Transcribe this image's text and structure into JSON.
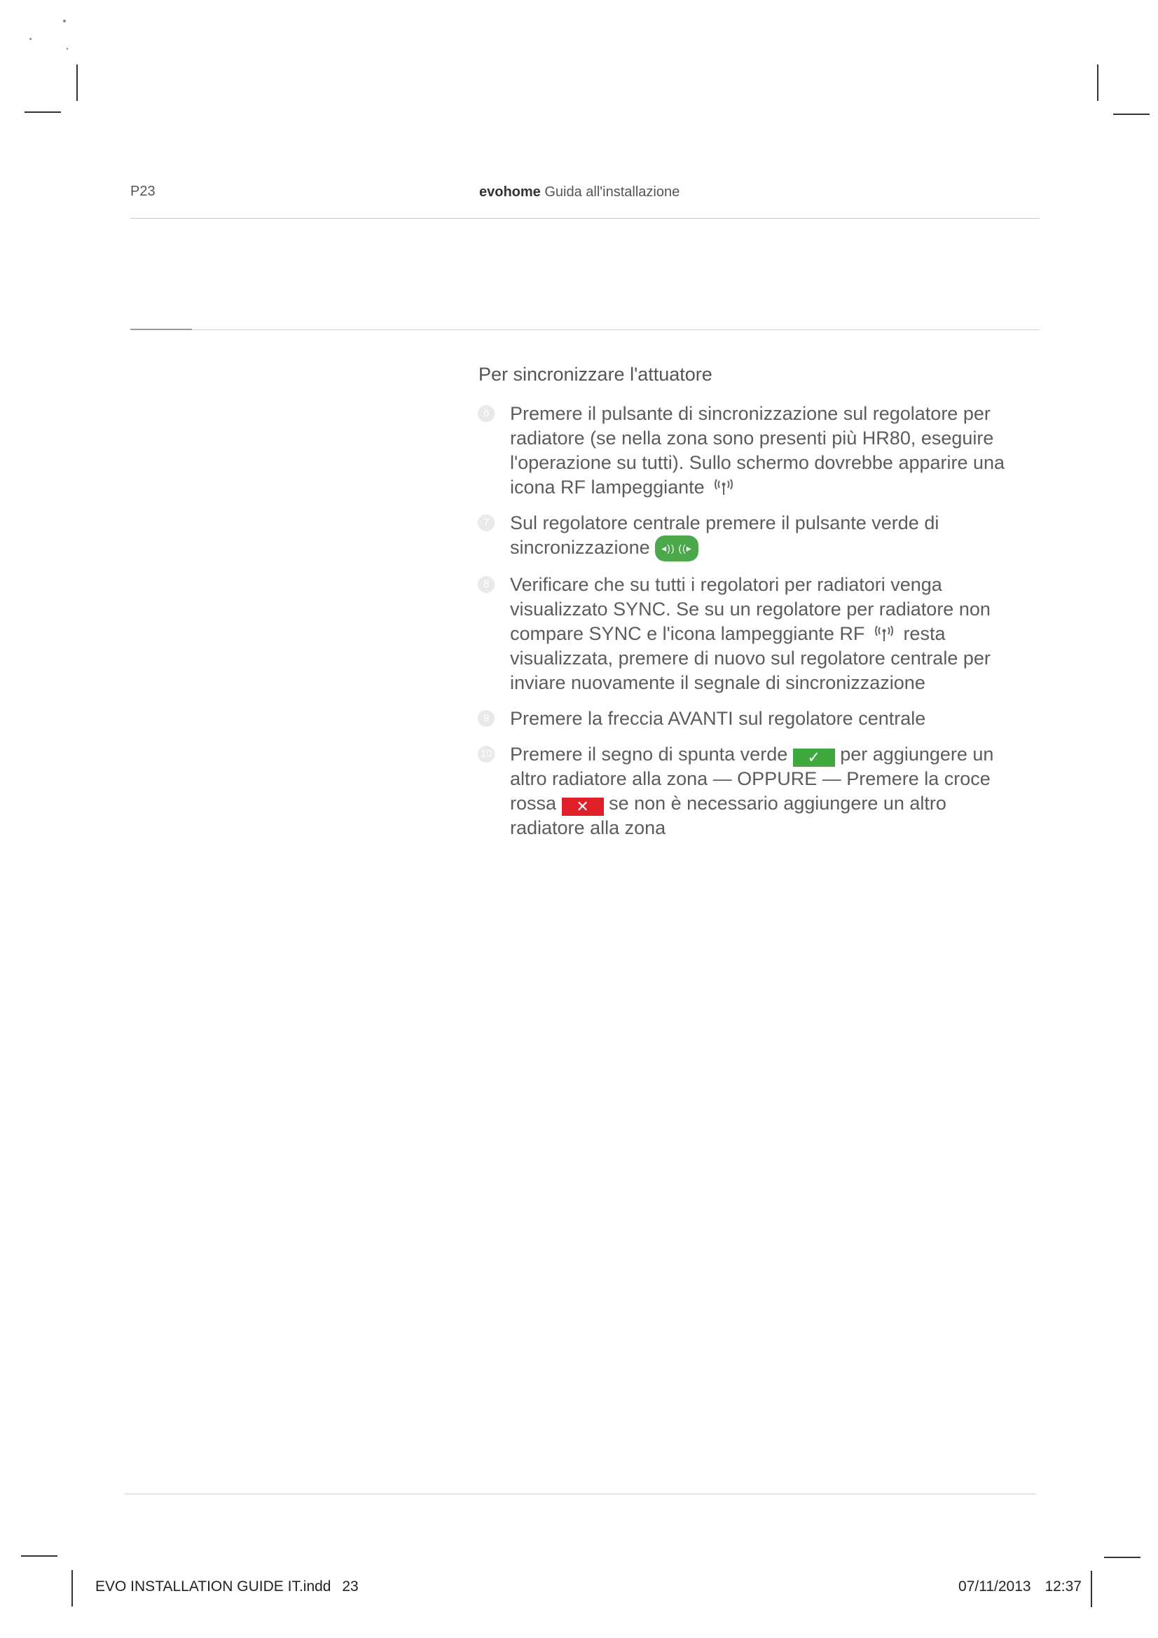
{
  "header": {
    "page_number": "P23",
    "brand": "evohome",
    "guide_title": "Guida all'installazione"
  },
  "section": {
    "title": "Per sincronizzare l'attuatore",
    "steps": [
      {
        "number": "6",
        "text": "Premere il pulsante di sincronizzazione sul regolatore per radiatore (se nella zona sono presenti più HR80, eseguire l'operazione su tutti). Sullo schermo dovrebbe apparire una icona RF lampeggiante",
        "icon": "rf-antenna-icon"
      },
      {
        "number": "7",
        "text": "Sul regolatore centrale premere il pulsante verde di sincronizzazione",
        "icon": "sync-button-icon"
      },
      {
        "number": "8",
        "text_before": "Verificare che su tutti i regolatori per radiatori venga visualizzato SYNC. Se su un regolatore per radiatore non compare SYNC e l'icona lampeggiante RF",
        "text_after": "resta visualizzata, premere di nuovo sul regolatore centrale per inviare nuovamente il segnale di sincronizzazione",
        "icon": "rf-antenna-icon"
      },
      {
        "number": "9",
        "text": "Premere la freccia AVANTI sul regolatore centrale"
      },
      {
        "number": "10",
        "text_1": "Premere il segno di spunta verde",
        "text_2": "per aggiungere un altro radiatore alla zona — OPPURE — Premere la croce rossa",
        "text_3": "se non è necessario aggiungere un altro radiatore alla zona",
        "icon_tick": "green-check-icon",
        "icon_cross": "red-cross-icon"
      }
    ]
  },
  "footer": {
    "file_name": "EVO INSTALLATION GUIDE IT.indd",
    "file_page": "23",
    "date": "07/11/2013",
    "time": "12:37"
  },
  "colors": {
    "green": "#3fa93f",
    "red": "#e02028",
    "text": "#5c5c5c"
  }
}
